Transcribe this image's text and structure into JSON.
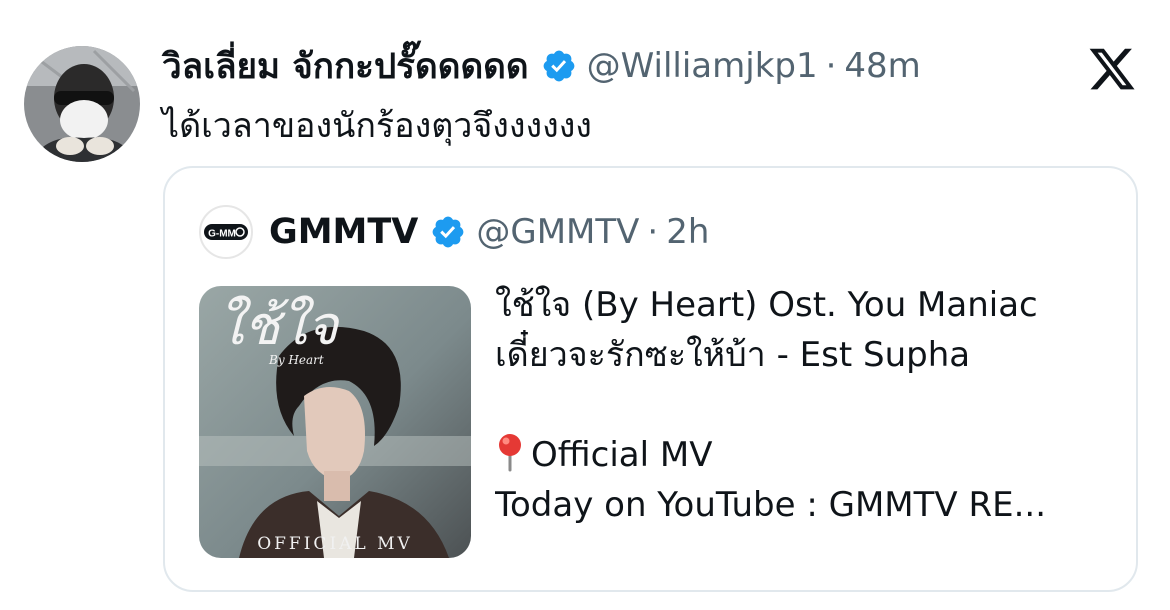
{
  "tweet": {
    "author": {
      "display_name": "วิลเลี่ยม จักกะปรั๊ดดดดด",
      "handle": "@Williamjkp1",
      "separator": "·",
      "time": "48m"
    },
    "text": "ได้เวลาของนักร้องตุวจึงงงงงง"
  },
  "quote": {
    "author": {
      "avatar_text": "G-MM",
      "display_name": "GMMTV",
      "handle": "@GMMTV",
      "separator": "·",
      "time": "2h"
    },
    "media": {
      "cover_title": "ใช้ใจ",
      "cover_subtitle": "By Heart",
      "cover_caption": "OFFICIAL MV"
    },
    "lines": [
      "ใช้ใจ (By Heart) Ost. You Maniac",
      "เดี๋ยวจะรักซะให้บ้า - Est Supha",
      "",
      "Official MV",
      "Today on YouTube : GMMTV RE..."
    ]
  },
  "icons": {
    "verified": "verified-badge-icon",
    "brand": "x-logo-icon",
    "pin": "round-pushpin-icon"
  },
  "colors": {
    "verified_blue": "#1d9bf0",
    "secondary_text": "#536471",
    "primary_text": "#0f1419",
    "card_border": "#e1e8ed"
  }
}
